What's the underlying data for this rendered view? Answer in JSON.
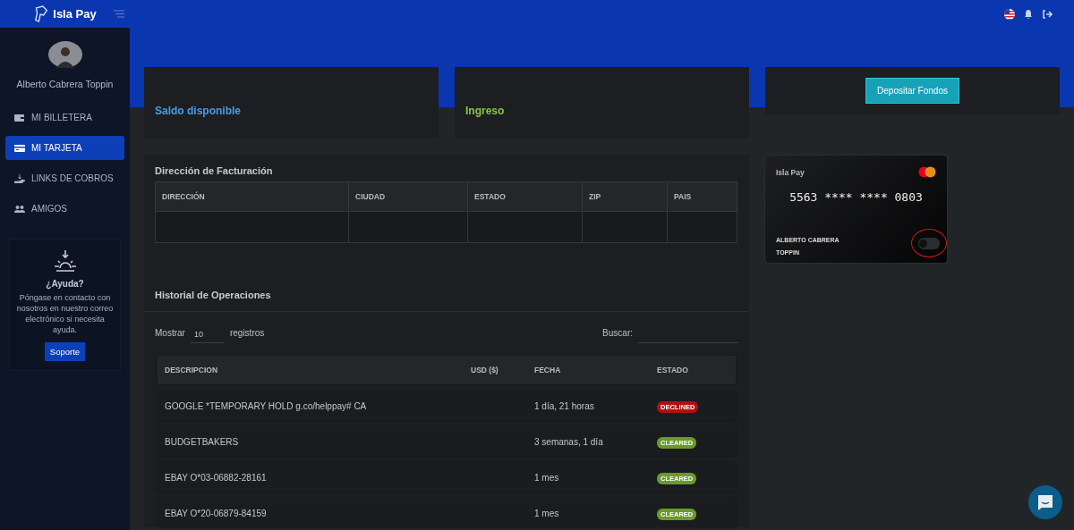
{
  "header": {
    "brand": "Isla Pay"
  },
  "sidebar": {
    "user_name": "Alberto Cabrera Toppin",
    "items": [
      {
        "label": "MI BILLETERA",
        "kind": "wallet",
        "selected": false
      },
      {
        "label": "MI TARJETA",
        "kind": "card",
        "selected": true
      },
      {
        "label": "LINKS DE COBROS",
        "kind": "hand",
        "selected": false
      },
      {
        "label": "AMIGOS",
        "kind": "users",
        "selected": false
      }
    ],
    "help": {
      "title": "¿Ayuda?",
      "text": "Póngase en contacto con nosotros en nuestro correo electrónico si necesita ayuda.",
      "button": "Soporte"
    }
  },
  "summary": [
    {
      "label": "Saldo disponible",
      "kind": "balance"
    },
    {
      "label": "Ingreso",
      "kind": "income"
    }
  ],
  "deposit_button": "Depositar Fondos",
  "billing": {
    "title": "Dirección de Facturación",
    "columns": [
      "DIRECCIÓN",
      "CIUDAD",
      "ESTADO",
      "ZIP",
      "PAIS"
    ]
  },
  "history": {
    "title": "Historial de Operaciones",
    "show_label": "Mostrar",
    "page_size": "10",
    "records_label": "registros",
    "search_label": "Buscar:",
    "columns": [
      "DESCRIPCION",
      "USD ($)",
      "FECHA",
      "ESTADO"
    ],
    "rows": [
      {
        "description": "GOOGLE *TEMPORARY HOLD g.co/helppay# CA",
        "date": "1 día, 21 horas",
        "status": "DECLINED",
        "kind": "declined"
      },
      {
        "description": "BUDGETBAKERS",
        "date": "3 semanas, 1 día",
        "status": "CLEARED",
        "kind": "cleared"
      },
      {
        "description": "EBAY O*03-06882-28161",
        "date": "1 mes",
        "status": "CLEARED",
        "kind": "cleared"
      },
      {
        "description": "EBAY O*20-06879-84159",
        "date": "1 mes",
        "status": "CLEARED",
        "kind": "cleared"
      }
    ]
  },
  "card": {
    "brand": "Isla Pay",
    "number": "5563 **** **** 0803",
    "holder": "ALBERTO CABRERA TOPPIN",
    "on": false
  }
}
